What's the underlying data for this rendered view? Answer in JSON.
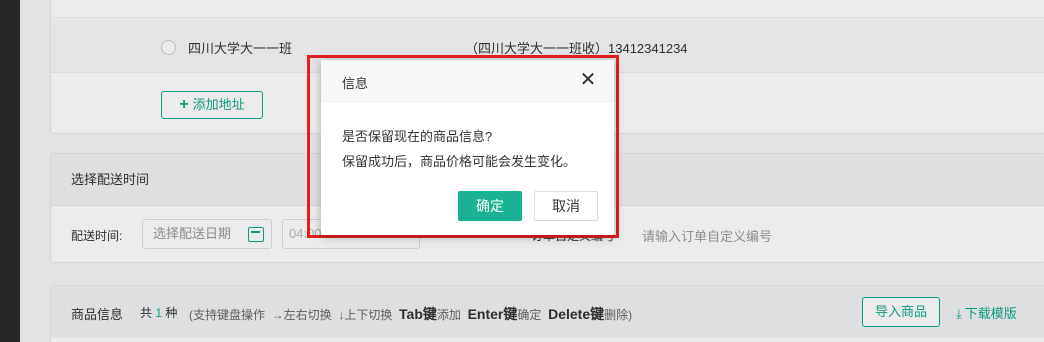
{
  "address": {
    "selected_name": "四川大学大一一班",
    "selected_detail": "（四川大学大一一班收）13412341234",
    "add_button": "添加地址",
    "add_icon": "plus-icon"
  },
  "delivery": {
    "section_title": "选择配送时间",
    "time_label": "配送时间:",
    "date_placeholder": "选择配送日期",
    "time_value": "04:00 - 06:00",
    "custom_label": "订单自定义编号",
    "custom_placeholder": "请输入订单自定义编号",
    "date_icon": "calendar-icon"
  },
  "goods": {
    "title": "商品信息",
    "count_prefix": "共",
    "count": "1",
    "count_suffix": "种",
    "hint_open": "(支持键盘操作",
    "hint_arrow_lr": "→左右切换",
    "hint_arrow_ud": "↓上下切换",
    "hint_tab_key": "Tab键",
    "hint_tab_action": "添加",
    "hint_enter_key": "Enter键",
    "hint_enter_action": "确定",
    "hint_delete_key": "Delete键",
    "hint_delete_action": "删除)",
    "import_button": "导入商品",
    "download_link": "下载模版",
    "accent_color": "#13a88a"
  },
  "dialog": {
    "title": "信息",
    "close_symbol": "✕",
    "message_line1": "是否保留现在的商品信息?",
    "message_line2": "保留成功后，商品价格可能会发生变化。",
    "ok_label": "确定",
    "cancel_label": "取消",
    "ok_color": "#19b393",
    "highlight_color": "#e02020"
  }
}
